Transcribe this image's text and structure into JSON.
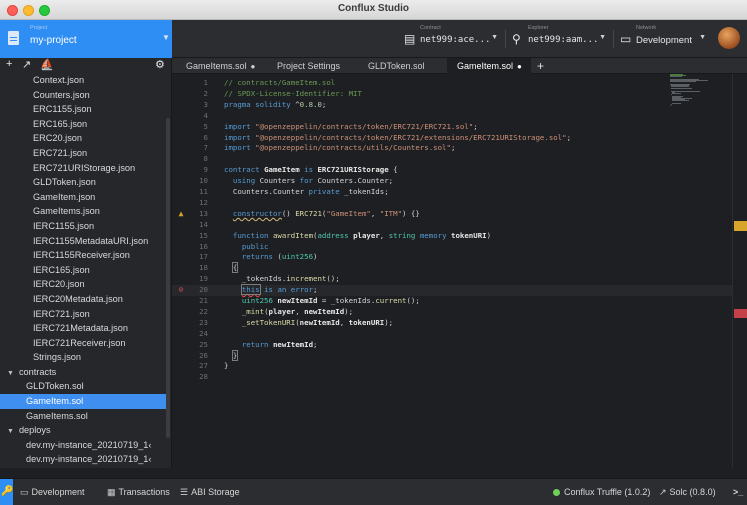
{
  "window": {
    "title": "Conflux Studio"
  },
  "toolbar": {
    "project_caption": "Project",
    "project_name": "my-project",
    "contract_caption": "Contract",
    "contract_value": "net999:ace...",
    "explorer_caption": "Explorer",
    "explorer_value": "net999:aam...",
    "network_caption": "Network",
    "network_value": "Development"
  },
  "sidebar": {
    "items": [
      {
        "label": "Context.json",
        "level": 2
      },
      {
        "label": "Counters.json",
        "level": 2
      },
      {
        "label": "ERC1155.json",
        "level": 2
      },
      {
        "label": "ERC165.json",
        "level": 2
      },
      {
        "label": "ERC20.json",
        "level": 2
      },
      {
        "label": "ERC721.json",
        "level": 2
      },
      {
        "label": "ERC721URIStorage.json",
        "level": 2
      },
      {
        "label": "GLDToken.json",
        "level": 2
      },
      {
        "label": "GameItem.json",
        "level": 2
      },
      {
        "label": "GameItems.json",
        "level": 2
      },
      {
        "label": "IERC1155.json",
        "level": 2
      },
      {
        "label": "IERC1155MetadataURI.json",
        "level": 2
      },
      {
        "label": "IERC1155Receiver.json",
        "level": 2
      },
      {
        "label": "IERC165.json",
        "level": 2
      },
      {
        "label": "IERC20.json",
        "level": 2
      },
      {
        "label": "IERC20Metadata.json",
        "level": 2
      },
      {
        "label": "IERC721.json",
        "level": 2
      },
      {
        "label": "IERC721Metadata.json",
        "level": 2
      },
      {
        "label": "IERC721Receiver.json",
        "level": 2
      },
      {
        "label": "Strings.json",
        "level": 2
      },
      {
        "label": "contracts",
        "level": 1,
        "folder": true
      },
      {
        "label": "GLDToken.sol",
        "level": 3
      },
      {
        "label": "GameItem.sol",
        "level": 3,
        "selected": true
      },
      {
        "label": "GameItems.sol",
        "level": 3
      },
      {
        "label": "deploys",
        "level": 1,
        "folder": true
      },
      {
        "label": "dev.my-instance_20210719_1‹",
        "level": 3
      },
      {
        "label": "dev.my-instance_20210719_1‹",
        "level": 3
      }
    ]
  },
  "tabs": [
    {
      "label": "GameItems.sol",
      "dot": "●",
      "active": false
    },
    {
      "label": "Project Settings",
      "dot": "",
      "active": false
    },
    {
      "label": "GLDToken.sol",
      "dot": "",
      "active": false
    },
    {
      "label": "GameItem.sol",
      "dot": "●",
      "active": true
    }
  ],
  "tab_add": "+",
  "code": {
    "lines": [
      {
        "n": "1",
        "text": "// contracts/GameItem.sol"
      },
      {
        "n": "2",
        "text": "// SPDX-License-Identifier: MIT"
      },
      {
        "n": "3",
        "text": "pragma solidity ^0.8.0;"
      },
      {
        "n": "4",
        "text": ""
      },
      {
        "n": "5",
        "text": "import \"@openzeppelin/contracts/token/ERC721/ERC721.sol\";"
      },
      {
        "n": "6",
        "text": "import \"@openzeppelin/contracts/token/ERC721/extensions/ERC721URIStorage.sol\";"
      },
      {
        "n": "7",
        "text": "import \"@openzeppelin/contracts/utils/Counters.sol\";"
      },
      {
        "n": "8",
        "text": ""
      },
      {
        "n": "9",
        "text": "contract GameItem is ERC721URIStorage {"
      },
      {
        "n": "10",
        "text": "  using Counters for Counters.Counter;"
      },
      {
        "n": "11",
        "text": "  Counters.Counter private _tokenIds;"
      },
      {
        "n": "12",
        "text": ""
      },
      {
        "n": "13",
        "text": "  constructor() ERC721(\"GameItem\", \"ITM\") {}"
      },
      {
        "n": "14",
        "text": ""
      },
      {
        "n": "15",
        "text": "  function awardItem(address player, string memory tokenURI)"
      },
      {
        "n": "16",
        "text": "    public"
      },
      {
        "n": "17",
        "text": "    returns (uint256)"
      },
      {
        "n": "18",
        "text": "  {"
      },
      {
        "n": "19",
        "text": "    _tokenIds.increment();"
      },
      {
        "n": "20",
        "text": "    this is an error;"
      },
      {
        "n": "21",
        "text": "    uint256 newItemId = _tokenIds.current();"
      },
      {
        "n": "22",
        "text": "    _mint(player, newItemId);"
      },
      {
        "n": "23",
        "text": "    _setTokenURI(newItemId, tokenURI);"
      },
      {
        "n": "24",
        "text": ""
      },
      {
        "n": "25",
        "text": "    return newItemId;"
      },
      {
        "n": "26",
        "text": "  }"
      },
      {
        "n": "27",
        "text": "}"
      },
      {
        "n": "28",
        "text": ""
      }
    ]
  },
  "statusbar": {
    "development": "Development",
    "transactions": "Transactions",
    "abi_storage": "ABI Storage",
    "truffle": "Conflux Truffle (1.0.2)",
    "solc": "Solc (0.8.0)"
  },
  "colors": {
    "accent": "#2f8ef4",
    "warning": "#d8a62a",
    "error": "#c6404a",
    "connected": "#6fcf58"
  }
}
